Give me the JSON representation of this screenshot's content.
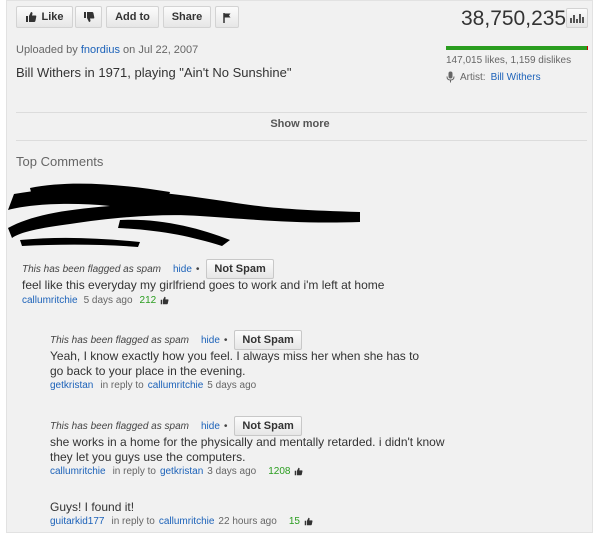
{
  "toolbar": {
    "like_label": "Like",
    "add_to_label": "Add to",
    "share_label": "Share",
    "view_count": "38,750,235"
  },
  "video": {
    "uploaded_prefix": "Uploaded by",
    "uploader": "fnordius",
    "uploaded_suffix": "on Jul 22, 2007",
    "title": "Bill Withers in 1971, playing \"Ain't No Sunshine\"",
    "likes_text": "147,015 likes, 1,159 dislikes",
    "like_ratio": 0.992,
    "artist_prefix": "Artist:",
    "artist_name": "Bill Withers"
  },
  "show_more_label": "Show more",
  "comments_title": "Top Comments",
  "flag_text": "This has been flagged as spam",
  "hide_label": "hide",
  "bullet": "•",
  "not_spam_label": "Not Spam",
  "in_reply_to": "in reply to",
  "comments": [
    {
      "text": "feel like this everyday my girlfriend goes to work and i'm left at home",
      "author": "callumritchie",
      "time": "5 days ago",
      "score": "212"
    },
    {
      "text": "Yeah, I know exactly how you feel. I always miss her when she has to go back to your place in the evening.",
      "author": "getkristan",
      "reply_to": "callumritchie",
      "time": "5 days ago"
    },
    {
      "text": "she works in a home for the physically and mentally retarded. i didn't know they let you guys use the computers.",
      "author": "callumritchie",
      "reply_to": "getkristan",
      "time": "3 days ago",
      "score": "1208"
    },
    {
      "text": "Guys! I found it!",
      "author": "guitarkid177",
      "reply_to": "callumritchie",
      "time": "22 hours ago",
      "score": "15"
    }
  ],
  "colors": {
    "link": "#1c62b9",
    "like_bar": "#2a9d1f",
    "dislike_bar": "#cc0000",
    "score": "#2a9d1f"
  }
}
